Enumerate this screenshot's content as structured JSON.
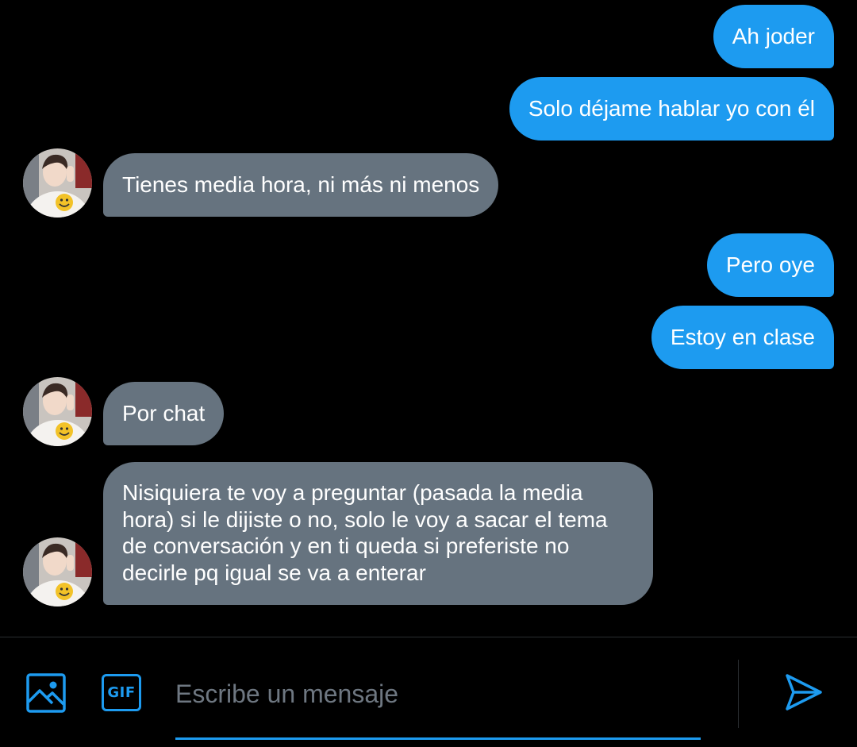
{
  "colors": {
    "background": "#000000",
    "outgoing_bubble": "#1d9bf0",
    "incoming_bubble": "#66737f",
    "accent": "#1d9bf0",
    "placeholder": "#6e7781"
  },
  "messages": [
    {
      "direction": "outgoing",
      "text": "Ah joder"
    },
    {
      "direction": "outgoing",
      "text": "Solo déjame hablar yo con él"
    },
    {
      "direction": "incoming",
      "text": "Tienes media hora, ni más ni menos"
    },
    {
      "direction": "outgoing",
      "text": "Pero oye"
    },
    {
      "direction": "outgoing",
      "text": "Estoy en clase"
    },
    {
      "direction": "incoming",
      "text": "Por chat"
    },
    {
      "direction": "incoming",
      "text": "Nisiquiera te voy a preguntar (pasada la media hora) si le dijiste o no, solo le voy a sacar el tema de conversación y en ti queda si preferiste no decirle pq igual se va a enterar"
    }
  ],
  "composer": {
    "placeholder": "Escribe un mensaje",
    "value": "",
    "image_icon": "image-icon",
    "gif_icon": "gif-icon",
    "gif_label": "GIF",
    "send_icon": "send-icon"
  }
}
